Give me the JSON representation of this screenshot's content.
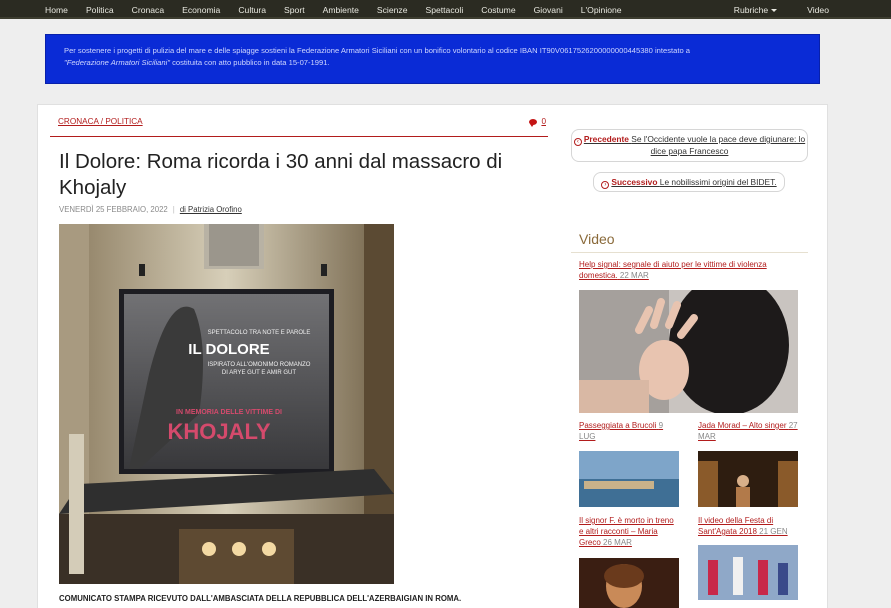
{
  "nav": {
    "items": [
      "Home",
      "Politica",
      "Cronaca",
      "Economia",
      "Cultura",
      "Sport",
      "Ambiente",
      "Scienze",
      "Spettacoli",
      "Costume",
      "Giovani",
      "L'Opinione"
    ],
    "rubriche": "Rubriche",
    "video": "Video"
  },
  "notice": {
    "line1": "Per sostenere i progetti di pulizia del mare e delle spiagge sostieni la Federazione Armatori Siciliani con un bonifico volontario al codice IBAN IT90V0617526200000000445380 intestato a",
    "quoted": "\"Federazione Armatori Siciliani\"",
    "line2": " costituita con atto pubblico in data 15-07-1991."
  },
  "article": {
    "breadcrumb": "CRONACA / POLITICA",
    "comments_count": "0",
    "title": "Il Dolore: Roma ricorda i 30 anni dal massacro di Khojaly",
    "date": "VENERDÌ 25 FEBBRAIO, 2022",
    "author": "di Patrizia Orofino",
    "caption": "COMUNICATO STAMPA RICEVUTO DALL'AMBASCIATA DELLA REPUBBLICA DELL'AZERBAIGIAN IN ROMA.",
    "banner": {
      "line1": "SPETTACOLO TRA NOTE E PAROLE",
      "line2": "IL DOLORE",
      "line3": "ISPIRATO ALL'OMONIMO ROMANZO",
      "line4": "DI ARYE GUT E AMIR GUT",
      "line5": "IN MEMORIA DELLE VITTIME DI",
      "line6": "KHOJALY"
    }
  },
  "sidebar": {
    "prev_label": "Precedente",
    "prev_text": "Se l'Occidente vuole la pace deve digiunare: lo dice papa Francesco",
    "next_label": "Successivo",
    "next_text": "Le nobilissimi origini del BIDET.",
    "video_heading": "Video",
    "videos": [
      {
        "title": "Help signal: segnale di aiuto per le vittime di violenza domestica.",
        "date": "22 MAR"
      },
      {
        "title": "Passeggiata a Brucoli",
        "date": "9 LUG"
      },
      {
        "title": "Jada Morad – Alto singer",
        "date": "27 MAR"
      },
      {
        "title": "Il signor F. è morto in treno e altri racconti – Maria Greco",
        "date": "26 MAR"
      },
      {
        "title": "Il video della Festa di Sant'Agata 2018",
        "date": "21 GEN"
      }
    ]
  },
  "colors": {
    "accent": "#b21c1c",
    "banner": "#0a2bd6",
    "nav": "#2b2b22"
  }
}
